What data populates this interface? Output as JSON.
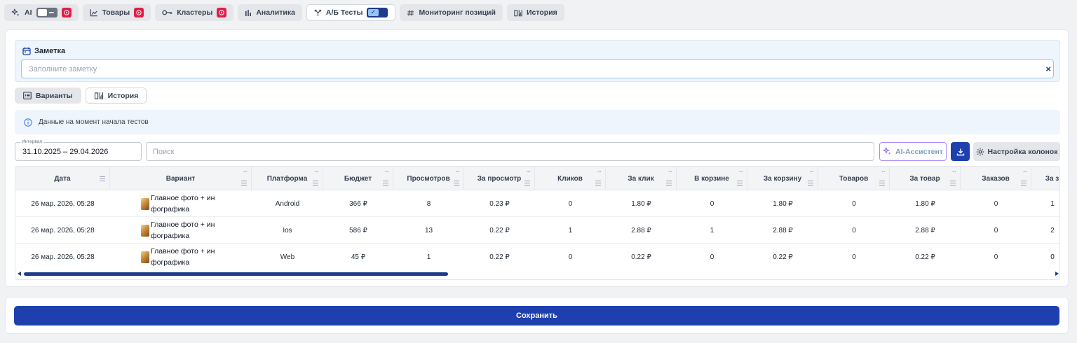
{
  "nav": {
    "ai_label": "AI",
    "items": [
      {
        "label": "Товары"
      },
      {
        "label": "Кластеры"
      },
      {
        "label": "Аналитика"
      },
      {
        "label": "А/Б Тесты"
      },
      {
        "label": "Мониторинг позиций"
      },
      {
        "label": "История"
      }
    ]
  },
  "note": {
    "title": "Заметка",
    "placeholder": "Заполните заметку",
    "value": "",
    "clear_icon": "×"
  },
  "subtabs": [
    {
      "label": "Варианты"
    },
    {
      "label": "История"
    }
  ],
  "info": {
    "text": "Данные на момент начала тестов"
  },
  "filters": {
    "interval_label": "Интервал",
    "interval_value": "31.10.2025 – 29.04.2026",
    "search_placeholder": "Поиск",
    "ai_assistant_label": "AI-Ассистент",
    "columns_settings_label": "Настройка колонок"
  },
  "table": {
    "columns": [
      "Дата",
      "Вариант",
      "Платформа",
      "Бюджет",
      "Просмотров",
      "За просмотр",
      "Кликов",
      "За клик",
      "В корзине",
      "За корзину",
      "Товаров",
      "За товар",
      "Заказов",
      "За з"
    ],
    "rows": [
      [
        "26 мар. 2026, 05:28",
        "Главное фото + ин фографика",
        "Android",
        "366 ₽",
        "8",
        "0.23 ₽",
        "0",
        "1.80 ₽",
        "0",
        "1.80 ₽",
        "0",
        "1.80 ₽",
        "0",
        "1"
      ],
      [
        "26 мар. 2026, 05:28",
        "Главное фото + ин фографика",
        "Ios",
        "586 ₽",
        "13",
        "0.22 ₽",
        "1",
        "2.88 ₽",
        "1",
        "2.88 ₽",
        "0",
        "2.88 ₽",
        "0",
        "2"
      ],
      [
        "26 мар. 2026, 05:28",
        "Главное фото + ин фографика",
        "Web",
        "45 ₽",
        "1",
        "0.22 ₽",
        "0",
        "0.22 ₽",
        "0",
        "0.22 ₽",
        "0",
        "0.22 ₽",
        "0",
        "0"
      ]
    ]
  },
  "save": {
    "label": "Сохранить"
  },
  "colors": {
    "primary": "#1e40af",
    "youtube_badge": "#e11d48",
    "panel_bg": "#eef5fc"
  }
}
